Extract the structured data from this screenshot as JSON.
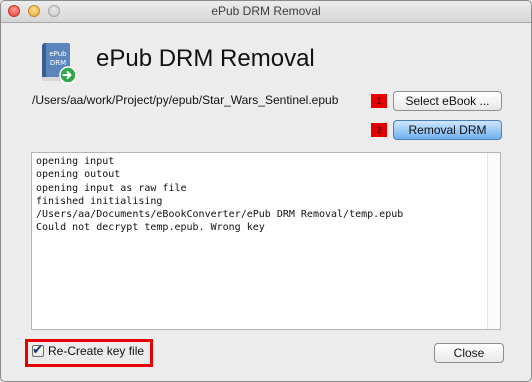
{
  "window": {
    "title": "ePub DRM Removal"
  },
  "header": {
    "app_name": "ePub DRM Removal",
    "icon_text_1": "ePub",
    "icon_text_2": "DRM"
  },
  "file": {
    "path": "/Users/aa/work/Project/py/epub/Star_Wars_Sentinel.epub"
  },
  "markers": {
    "m1": "1",
    "m2": "2",
    "color": "#e60000"
  },
  "buttons": {
    "select_label": "Select eBook ...",
    "remove_label": "Removal DRM",
    "close_label": "Close"
  },
  "log": {
    "lines": [
      "opening input",
      "opening outout",
      "opening input as raw file",
      "finished initialising",
      "/Users/aa/Documents/eBookConverter/ePub DRM Removal/temp.epub",
      "Could not decrypt temp.epub. Wrong key"
    ]
  },
  "options": {
    "recreate_key_label": "Re-Create key file",
    "recreate_key_checked": true
  }
}
